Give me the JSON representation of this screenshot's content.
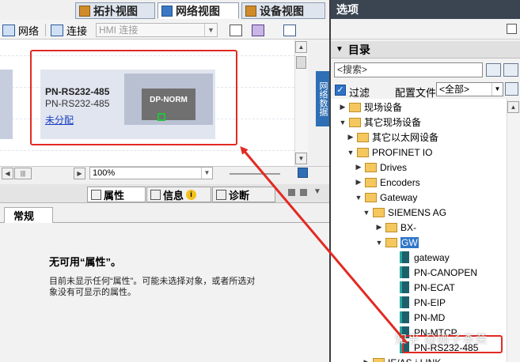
{
  "view_tabs": [
    {
      "label": "拓扑视图",
      "icon": "topology-view-icon"
    },
    {
      "label": "网络视图",
      "icon": "network-view-icon",
      "active": true
    },
    {
      "label": "设备视图",
      "icon": "device-view-icon"
    }
  ],
  "toolbar": {
    "network_label": "网络",
    "connect_label": "连接",
    "hmi_select": "HMI 连接"
  },
  "device": {
    "name_bold": "PN-RS232-485",
    "name": "PN-RS232-485",
    "assignment_link": "未分配",
    "module_label": "DP-NORM"
  },
  "side_tab_label": "网络数据",
  "zoom_value": "100%",
  "props": {
    "tabs": [
      {
        "label": "属性",
        "icon": "properties-icon"
      },
      {
        "label": "信息",
        "icon": "info-icon"
      },
      {
        "label": "诊断",
        "icon": "diagnostics-icon"
      }
    ],
    "normal_tab": "常规",
    "title": "无可用“属性”。",
    "text_line1": "目前未显示任何“属性”。可能未选择对象，或者所选对",
    "text_line2": "象没有可显示的属性。"
  },
  "options": {
    "title": "选项",
    "catalog_title": "目录",
    "search_placeholder": "<搜索>",
    "filter_label": "过滤",
    "filter_checked": true,
    "profile_label": "配置文件",
    "profile_value": "<全部>"
  },
  "tree": [
    {
      "label": "现场设备",
      "level": 1,
      "toggle": "collapsed",
      "icon": "folder"
    },
    {
      "label": "其它现场设备",
      "level": 1,
      "toggle": "expanded",
      "icon": "folder"
    },
    {
      "label": "其它以太网设备",
      "level": 2,
      "toggle": "collapsed",
      "icon": "folder"
    },
    {
      "label": "PROFINET IO",
      "level": 2,
      "toggle": "expanded",
      "icon": "folder"
    },
    {
      "label": "Drives",
      "level": 3,
      "toggle": "collapsed",
      "icon": "folder"
    },
    {
      "label": "Encoders",
      "level": 3,
      "toggle": "collapsed",
      "icon": "folder"
    },
    {
      "label": "Gateway",
      "level": 3,
      "toggle": "expanded",
      "icon": "folder"
    },
    {
      "label": "SIEMENS AG",
      "level": 4,
      "toggle": "expanded",
      "icon": "folder"
    },
    {
      "label": "BX-",
      "level": 5,
      "toggle": "collapsed",
      "icon": "folder"
    },
    {
      "label": "GW",
      "level": 5,
      "toggle": "expanded",
      "icon": "folder",
      "selected": true
    },
    {
      "label": "gateway",
      "level": 6,
      "toggle": "",
      "icon": "module"
    },
    {
      "label": "PN-CANOPEN",
      "level": 6,
      "toggle": "",
      "icon": "module"
    },
    {
      "label": "PN-ECAT",
      "level": 6,
      "toggle": "",
      "icon": "module"
    },
    {
      "label": "PN-EIP",
      "level": 6,
      "toggle": "",
      "icon": "module"
    },
    {
      "label": "PN-MD",
      "level": 6,
      "toggle": "",
      "icon": "module"
    },
    {
      "label": "PN-MTCP",
      "level": 6,
      "toggle": "",
      "icon": "module"
    },
    {
      "label": "PN-RS232-485",
      "level": 6,
      "toggle": "",
      "icon": "module"
    },
    {
      "label": "IE/AS-i LINK",
      "level": 4,
      "toggle": "collapsed",
      "icon": "folder"
    }
  ],
  "watermark": "知乎 @刚子李荣",
  "colors": {
    "highlight_red": "#e22a22",
    "selection_blue": "#2f76c8",
    "title_bar": "#3b4552"
  }
}
